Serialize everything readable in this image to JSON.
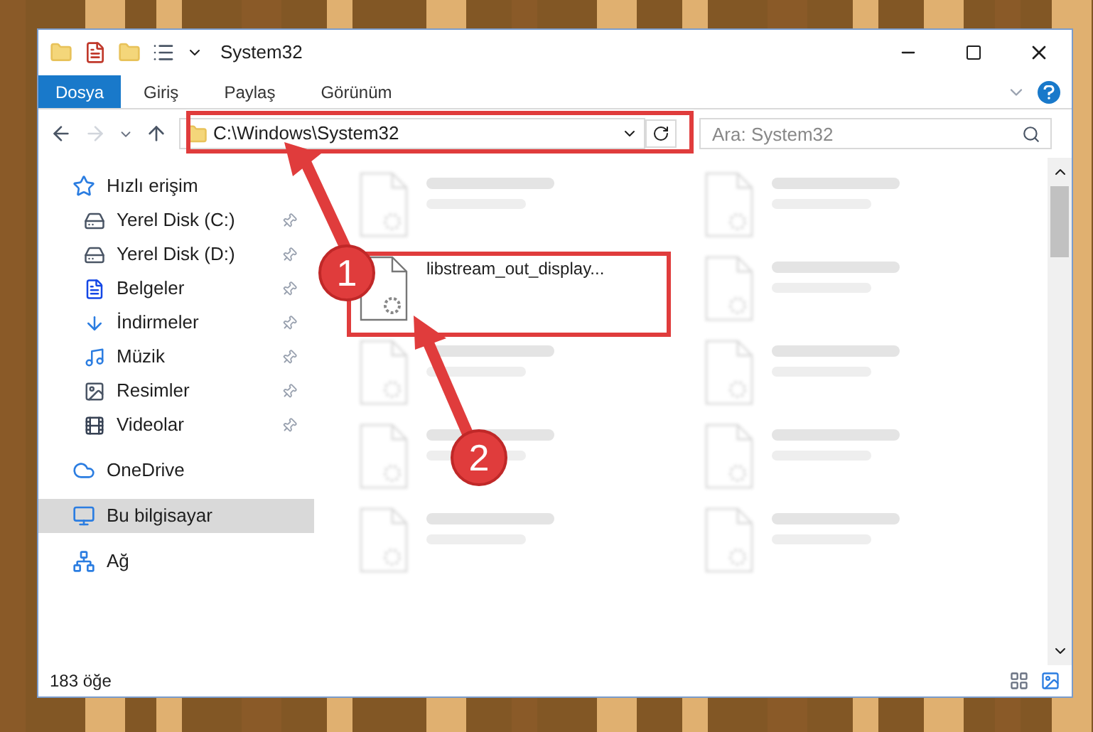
{
  "window": {
    "title": "System32"
  },
  "ribbon_tabs": [
    {
      "label": "Dosya",
      "selected": true
    },
    {
      "label": "Giriş",
      "selected": false
    },
    {
      "label": "Paylaş",
      "selected": false
    },
    {
      "label": "Görünüm",
      "selected": false
    }
  ],
  "address_bar": {
    "path": "C:\\Windows\\System32"
  },
  "search": {
    "placeholder": "Ara: System32"
  },
  "sidebar": {
    "items": [
      {
        "label": "Hızlı erişim",
        "selected": false,
        "children": [
          {
            "label": "Yerel Disk (C:)",
            "pinned": true
          },
          {
            "label": "Yerel Disk (D:)",
            "pinned": true
          },
          {
            "label": "Belgeler",
            "pinned": true
          },
          {
            "label": "İndirmeler",
            "pinned": true
          },
          {
            "label": "Müzik",
            "pinned": true
          },
          {
            "label": "Resimler",
            "pinned": true
          },
          {
            "label": "Videolar",
            "pinned": true
          }
        ]
      },
      {
        "label": "OneDrive",
        "selected": false
      },
      {
        "label": "Bu bilgisayar",
        "selected": true
      },
      {
        "label": "Ağ",
        "selected": false
      }
    ]
  },
  "files": [
    {
      "blurred": true
    },
    {
      "blurred": true
    },
    {
      "name": "libstream_out_display...",
      "blurred": false
    },
    {
      "blurred": true
    },
    {
      "blurred": true
    },
    {
      "blurred": true
    },
    {
      "blurred": true
    },
    {
      "blurred": true
    },
    {
      "blurred": true
    },
    {
      "blurred": true
    }
  ],
  "status_bar": {
    "count": "183 öğe"
  },
  "annotations": [
    {
      "number": "1"
    },
    {
      "number": "2"
    }
  ]
}
